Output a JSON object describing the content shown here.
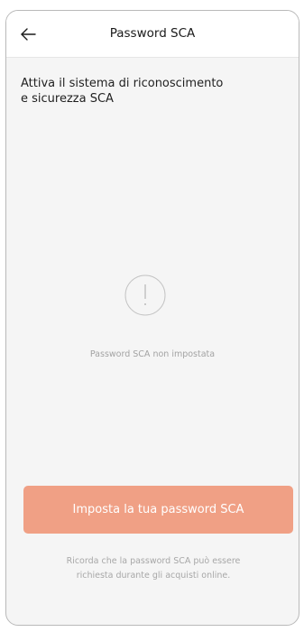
{
  "header": {
    "title": "Password SCA",
    "back_icon": "arrow-left-icon"
  },
  "intro": {
    "line1": "Attiva il sistema di riconoscimento",
    "line2": "e sicurezza SCA"
  },
  "status": {
    "icon": "exclamation-circle-icon",
    "text": "Password SCA non impostata"
  },
  "cta": {
    "label": "Imposta la tua password SCA",
    "color": "#f0a085"
  },
  "footnote": {
    "line1": "Ricorda che la password SCA può essere",
    "line2": "richiesta durante gli acquisti online."
  }
}
